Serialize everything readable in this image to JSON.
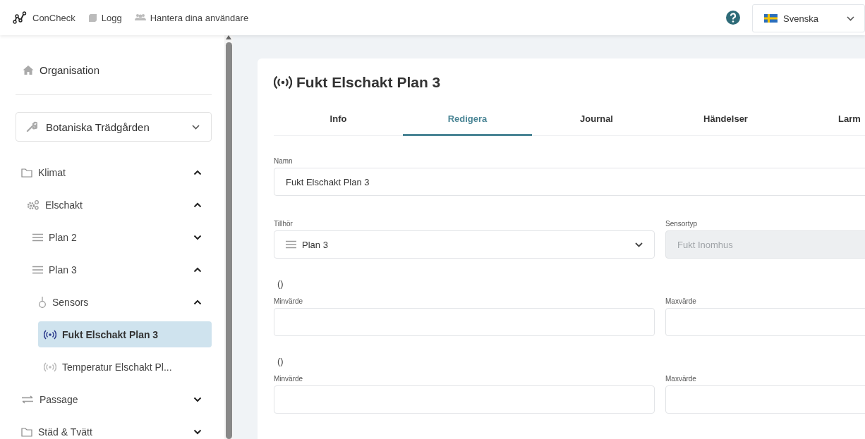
{
  "header": {
    "brand": "ConCheck",
    "nav": [
      {
        "label": "Logg",
        "kind": "book"
      },
      {
        "label": "Hantera dina användare",
        "kind": "users"
      }
    ],
    "language": "Svenska"
  },
  "sidebar": {
    "home": "Organisation",
    "organization": "Botaniska Trädgården",
    "tree": [
      {
        "label": "Klimat",
        "kind": "folder",
        "expanded": true,
        "selected": false,
        "children": [
          {
            "label": "Elschakt",
            "kind": "gears",
            "expanded": true,
            "selected": false,
            "children": [
              {
                "label": "Plan 2",
                "kind": "lines",
                "expanded": false,
                "selected": false
              },
              {
                "label": "Plan 3",
                "kind": "lines",
                "expanded": true,
                "selected": false,
                "children": [
                  {
                    "label": "Sensors",
                    "kind": "node",
                    "expanded": true,
                    "selected": false,
                    "children": [
                      {
                        "label": "Fukt Elschakt Plan 3",
                        "kind": "sensor",
                        "selected": true
                      },
                      {
                        "label": "Temperatur Elschakt Pl...",
                        "kind": "sensor",
                        "selected": false
                      }
                    ]
                  }
                ]
              }
            ]
          }
        ]
      },
      {
        "label": "Passage",
        "kind": "arrows",
        "expanded": false,
        "selected": false
      },
      {
        "label": "Städ & Tvätt",
        "kind": "folder",
        "expanded": false,
        "selected": false
      }
    ]
  },
  "detail": {
    "title": "Fukt Elschakt Plan 3",
    "tabs": [
      {
        "label": "Info",
        "selected": false
      },
      {
        "label": "Redigera",
        "selected": true
      },
      {
        "label": "Journal",
        "selected": false
      },
      {
        "label": "Händelser",
        "selected": false
      },
      {
        "label": "Larm",
        "selected": false
      }
    ],
    "name": {
      "label": "Namn",
      "value": "Fukt Elschakt Plan 3"
    },
    "belongs_to": {
      "label": "Tillhör",
      "value": "Plan 3"
    },
    "sensor_type": {
      "label": "Sensortyp",
      "value": "Fukt Inomhus",
      "disabled": true
    },
    "ranges": [
      {
        "heading": "()",
        "min_label": "Minvärde",
        "max_label": "Maxvärde"
      },
      {
        "heading": "()",
        "min_label": "Minvärde",
        "max_label": "Maxvärde"
      }
    ]
  }
}
